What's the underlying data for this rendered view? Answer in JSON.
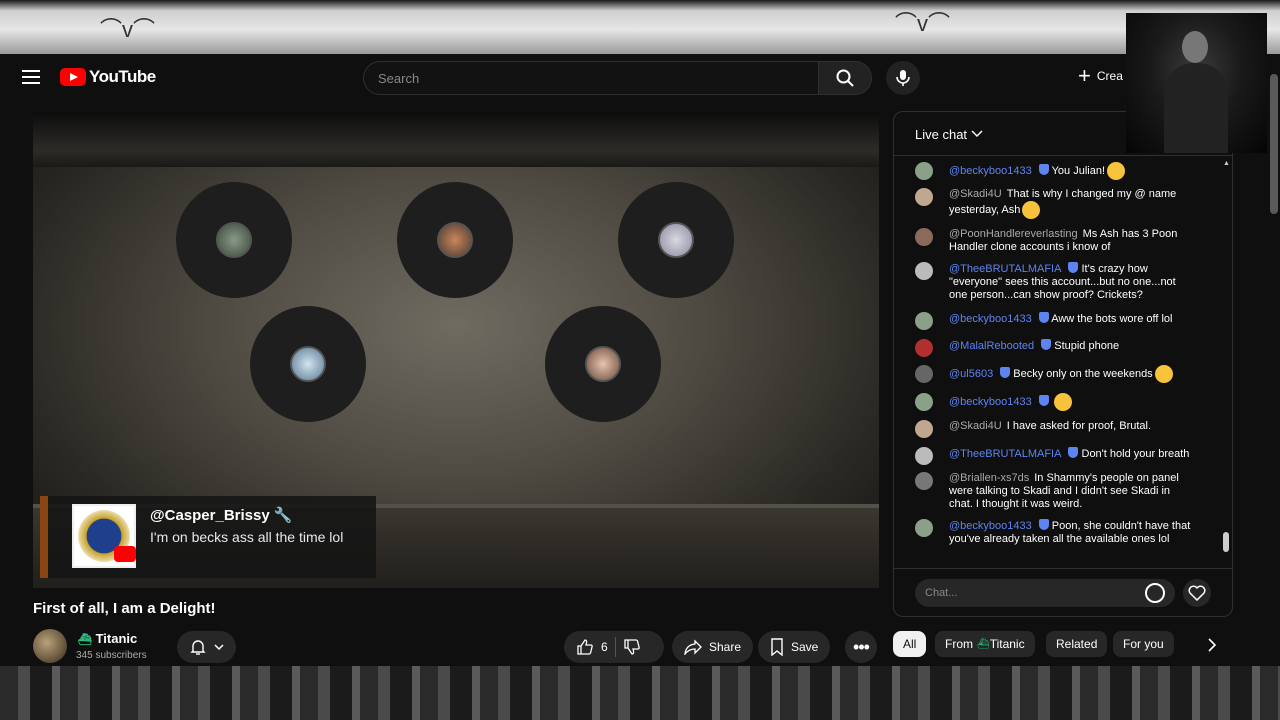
{
  "header": {
    "logo_text": "YouTube",
    "search_placeholder": "Search",
    "create_label": "Crea"
  },
  "video": {
    "overlay_comment": {
      "author": "@Casper_Brissy",
      "author_icon": "wrench-icon",
      "text": "I'm on becks ass all the time lol"
    }
  },
  "below_video": {
    "title": "First of all, I am a Delight!",
    "channel_name": "Titanic",
    "subscribers": "345 subscribers",
    "like_count": "6",
    "share_label": "Share",
    "save_label": "Save"
  },
  "live_chat": {
    "title": "Live chat",
    "input_placeholder": "Chat...",
    "messages": [
      {
        "author": "@beckyboo1433",
        "mod": true,
        "text": "You Julian!",
        "emoji": true
      },
      {
        "author": "@Skadi4U",
        "mod": false,
        "text": "That is why I changed my @ name yesterday, Ash",
        "emoji": true
      },
      {
        "author": "@PoonHandlereverlasting",
        "mod": false,
        "text": "Ms Ash has 3 Poon Handler clone accounts i know of",
        "emoji": false
      },
      {
        "author": "@TheeBRUTALMAFIA",
        "mod": true,
        "text": "It's crazy how \"everyone\" sees this account...but no one...not one person...can show proof? Crickets?",
        "emoji": false
      },
      {
        "author": "@beckyboo1433",
        "mod": true,
        "text": "Aww the bots wore off lol",
        "emoji": false
      },
      {
        "author": "@MalalRebooted",
        "mod": true,
        "text": "Stupid phone",
        "emoji": false
      },
      {
        "author": "@ul5603",
        "mod": true,
        "text": "Becky only on the weekends",
        "emoji": true
      },
      {
        "author": "@beckyboo1433",
        "mod": true,
        "text": "",
        "emoji": true
      },
      {
        "author": "@Skadi4U",
        "mod": false,
        "text": "I have asked for proof, Brutal.",
        "emoji": false
      },
      {
        "author": "@TheeBRUTALMAFIA",
        "mod": true,
        "text": "Don't hold your breath",
        "emoji": false
      },
      {
        "author": "@Briallen-xs7ds",
        "mod": false,
        "text": "In Shammy's people on panel were talking to Skadi and I didn't see Skadi in chat. I thought it was weird.",
        "emoji": false
      },
      {
        "author": "@beckyboo1433",
        "mod": true,
        "text": "Poon, she couldn't have that you've already taken all the available ones lol",
        "emoji": false
      }
    ]
  },
  "chips": [
    "All",
    "From",
    "Related",
    "For you"
  ],
  "chip_from_channel": "Titanic",
  "colors": {
    "accent_red": "#ff0000",
    "mod_blue": "#5e84f1",
    "bg": "#0f0f0f"
  }
}
